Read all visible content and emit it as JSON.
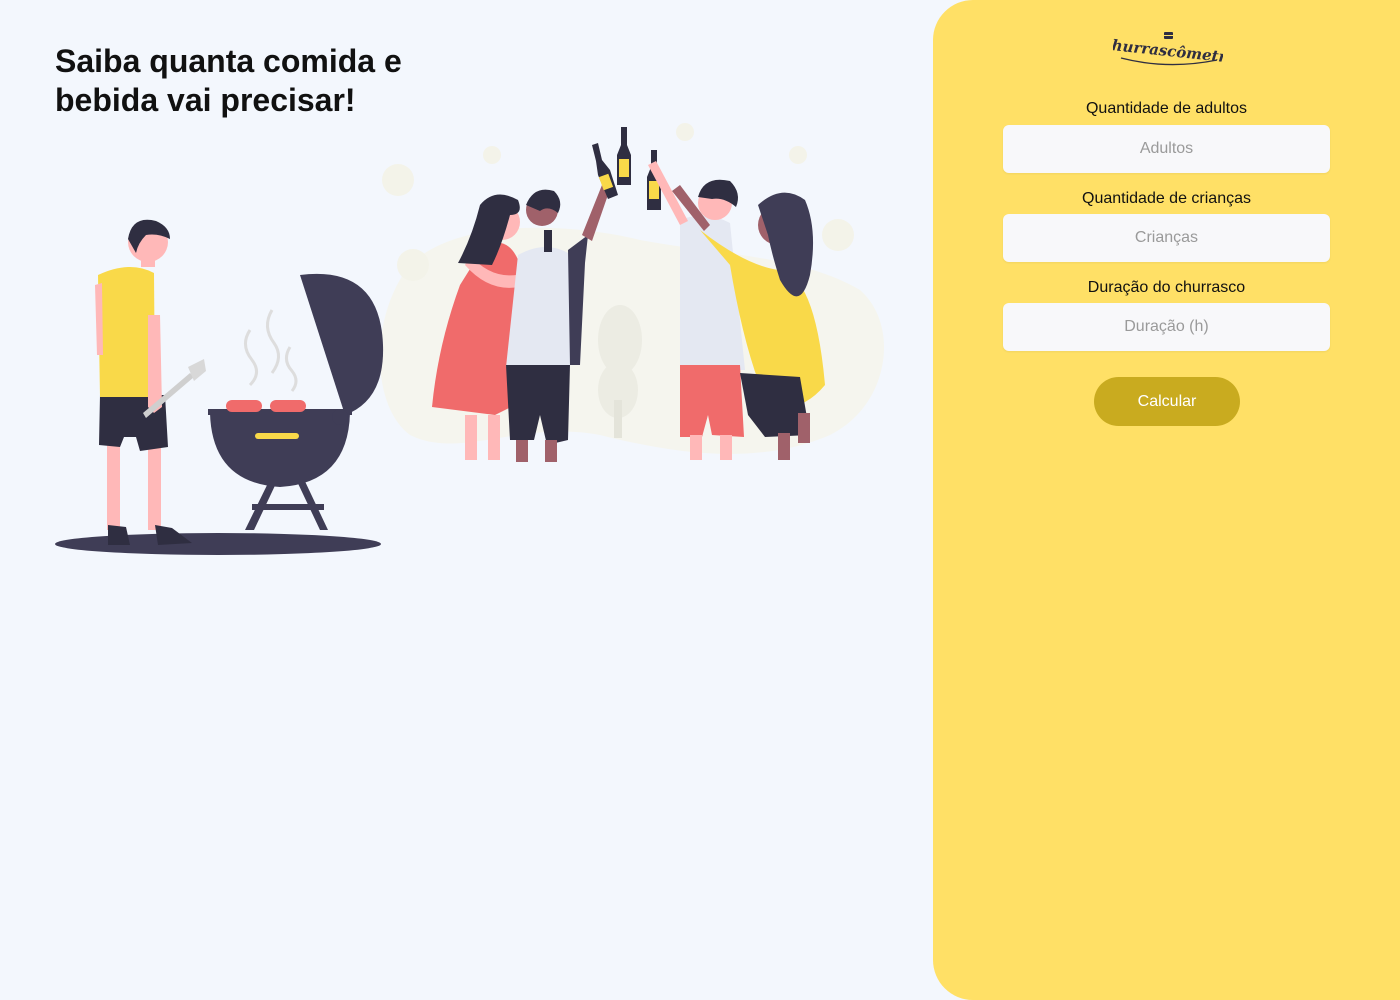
{
  "hero": {
    "title": "Saiba quanta comida e bebida vai precisar!"
  },
  "illustration": {
    "icon": "barbecue-party-illustration"
  },
  "form": {
    "logo_text": "Churrascômetro",
    "fields": [
      {
        "label": "Quantidade de adultos",
        "placeholder": "Adultos",
        "value": ""
      },
      {
        "label": "Quantidade de crianças",
        "placeholder": "Crianças",
        "value": ""
      },
      {
        "label": "Duração do churrasco",
        "placeholder": "Duração (h)",
        "value": ""
      }
    ],
    "submit_label": "Calcular"
  },
  "colors": {
    "background": "#f3f7fd",
    "panel": "#ffe066",
    "button": "#c9ab1f",
    "shirt_yellow": "#f9d949",
    "dark": "#3f3d56",
    "coral": "#f06b6b",
    "skin": "#ffb8b8"
  }
}
